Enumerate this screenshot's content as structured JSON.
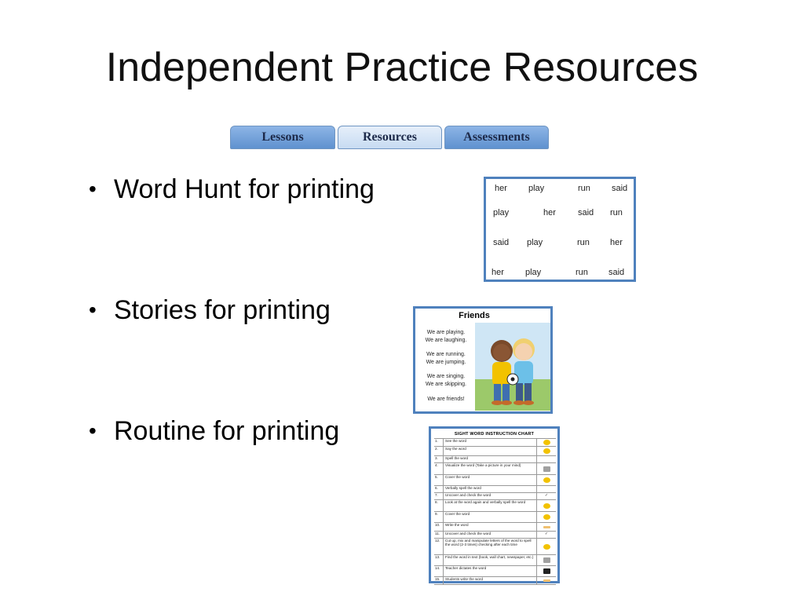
{
  "slide": {
    "title": "Independent Practice Resources"
  },
  "tabs": [
    {
      "label": "Lessons"
    },
    {
      "label": "Resources"
    },
    {
      "label": "Assessments"
    }
  ],
  "bullets": [
    {
      "text": "Word Hunt for printing"
    },
    {
      "text": "Stories for printing"
    },
    {
      "text": "Routine for printing"
    }
  ],
  "word_hunt": {
    "rows": [
      [
        "her",
        "play",
        "run",
        "said"
      ],
      [
        "play",
        "her",
        "said",
        "run"
      ],
      [
        "said",
        "play",
        "run",
        "her"
      ],
      [
        "her",
        "play",
        "run",
        "said"
      ]
    ]
  },
  "story": {
    "title": "Friends",
    "lines": [
      "We are playing.",
      "We are laughing.",
      "We are running.",
      "We are jumping.",
      "We are singing.",
      "We are skipping.",
      "We are friends!"
    ]
  },
  "routine_chart": {
    "title": "SIGHT WORD INSTRUCTION CHART",
    "rows": [
      {
        "num": "1.",
        "text": "See the word",
        "icon": "eyes-icon"
      },
      {
        "num": "2.",
        "text": "Say the word",
        "icon": "speaking-face-icon"
      },
      {
        "num": "3.",
        "text": "Spell the word",
        "icon": ""
      },
      {
        "num": "4.",
        "text": "Visualize the word (Take a picture in your mind)",
        "icon": "camera-icon"
      },
      {
        "num": "5.",
        "text": "Cover the word",
        "icon": "hand-icon"
      },
      {
        "num": "6.",
        "text": "Verbally spell the word",
        "icon": ""
      },
      {
        "num": "7.",
        "text": "Uncover and check the word",
        "icon": "check-icon"
      },
      {
        "num": "8.",
        "text": "Look at the word again and verbally spell the word",
        "icon": "magnifier-icon"
      },
      {
        "num": "9.",
        "text": "Cover the word",
        "icon": "hand-icon"
      },
      {
        "num": "10.",
        "text": "Write the word",
        "icon": "pencil-icon"
      },
      {
        "num": "11.",
        "text": "Uncover and check the word",
        "icon": "check-icon"
      },
      {
        "num": "12.",
        "text": "Cut up, mix and manipulate letters of the word to spell the word (2-3 times) checking after each time",
        "icon": "scissors-icon"
      },
      {
        "num": "13.",
        "text": "Find the word in text (book, wall chart, newspaper, etc.)",
        "icon": "books-icon"
      },
      {
        "num": "14.",
        "text": "Teacher dictates the word",
        "icon": "teacher-icon"
      },
      {
        "num": "15.",
        "text": "Students write the word",
        "icon": "pencil-icon"
      }
    ]
  }
}
